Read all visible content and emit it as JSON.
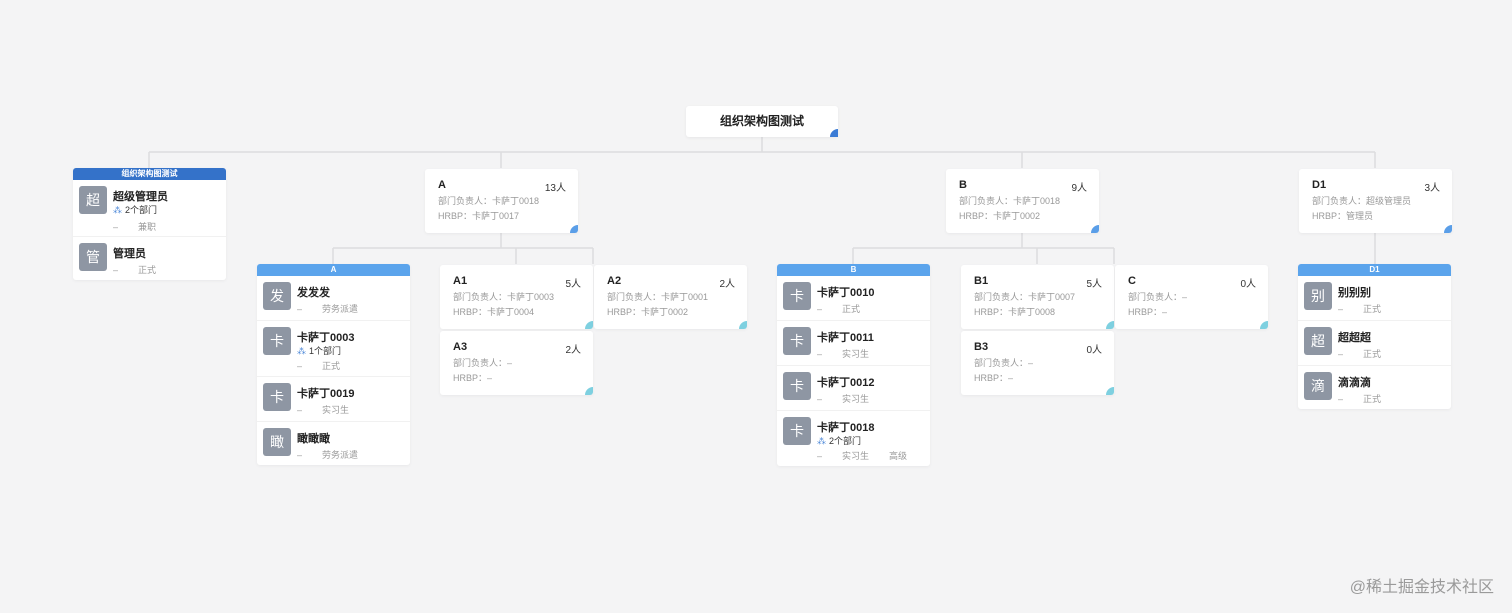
{
  "root": {
    "title": "组织架构图测试"
  },
  "root_members": {
    "header": "组织架构图测试",
    "items": [
      {
        "avatar": "超",
        "name": "超级管理员",
        "dept": "2个部门",
        "dash": "–",
        "type": "兼职"
      },
      {
        "avatar": "管",
        "name": "管理员",
        "dash": "–",
        "type": "正式"
      }
    ]
  },
  "depts": {
    "A": {
      "name": "A",
      "count": "13人",
      "lead": "部门负责人：卡萨丁0018",
      "hrbp": "HRBP：卡萨丁0017"
    },
    "B": {
      "name": "B",
      "count": "9人",
      "lead": "部门负责人：卡萨丁0018",
      "hrbp": "HRBP：卡萨丁0002"
    },
    "D1": {
      "name": "D1",
      "count": "3人",
      "lead": "部门负责人：超级管理员",
      "hrbp": "HRBP：管理员"
    },
    "A1": {
      "name": "A1",
      "count": "5人",
      "lead": "部门负责人：卡萨丁0003",
      "hrbp": "HRBP：卡萨丁0004"
    },
    "A2": {
      "name": "A2",
      "count": "2人",
      "lead": "部门负责人：卡萨丁0001",
      "hrbp": "HRBP：卡萨丁0002"
    },
    "A3": {
      "name": "A3",
      "count": "2人",
      "lead": "部门负责人：–",
      "hrbp": "HRBP：–"
    },
    "B1": {
      "name": "B1",
      "count": "5人",
      "lead": "部门负责人：卡萨丁0007",
      "hrbp": "HRBP：卡萨丁0008"
    },
    "C": {
      "name": "C",
      "count": "0人",
      "lead": "部门负责人：–",
      "hrbp": "HRBP：–"
    },
    "B3": {
      "name": "B3",
      "count": "0人",
      "lead": "部门负责人：–",
      "hrbp": "HRBP：–"
    }
  },
  "a_members": {
    "header": "A",
    "items": [
      {
        "avatar": "发",
        "name": "发发发",
        "dash": "–",
        "type": "劳务派遣"
      },
      {
        "avatar": "卡",
        "name": "卡萨丁0003",
        "dept": "1个部门",
        "dash": "–",
        "type": "正式"
      },
      {
        "avatar": "卡",
        "name": "卡萨丁0019",
        "dash": "–",
        "type": "实习生"
      },
      {
        "avatar": "瞰",
        "name": "瞰瞰瞰",
        "dash": "–",
        "type": "劳务派遣"
      }
    ]
  },
  "b_members": {
    "header": "B",
    "items": [
      {
        "avatar": "卡",
        "name": "卡萨丁0010",
        "dash": "–",
        "type": "正式"
      },
      {
        "avatar": "卡",
        "name": "卡萨丁0011",
        "dash": "–",
        "type": "实习生"
      },
      {
        "avatar": "卡",
        "name": "卡萨丁0012",
        "dash": "–",
        "type": "实习生"
      },
      {
        "avatar": "卡",
        "name": "卡萨丁0018",
        "dept": "2个部门",
        "dash": "–",
        "type": "实习生",
        "level": "高级"
      }
    ]
  },
  "d1_members": {
    "header": "D1",
    "items": [
      {
        "avatar": "别",
        "name": "别别别",
        "dash": "–",
        "type": "正式"
      },
      {
        "avatar": "超",
        "name": "超超超",
        "dash": "–",
        "type": "正式"
      },
      {
        "avatar": "滴",
        "name": "滴滴滴",
        "dash": "–",
        "type": "正式"
      }
    ]
  },
  "icons": {
    "org": "org-tree-icon"
  },
  "colors": {
    "header_dark": "#3472c9",
    "header_light": "#5ba4ec",
    "avatar": "#8e96a3",
    "background": "#f4f4f5"
  },
  "watermark": "@稀土掘金技术社区"
}
